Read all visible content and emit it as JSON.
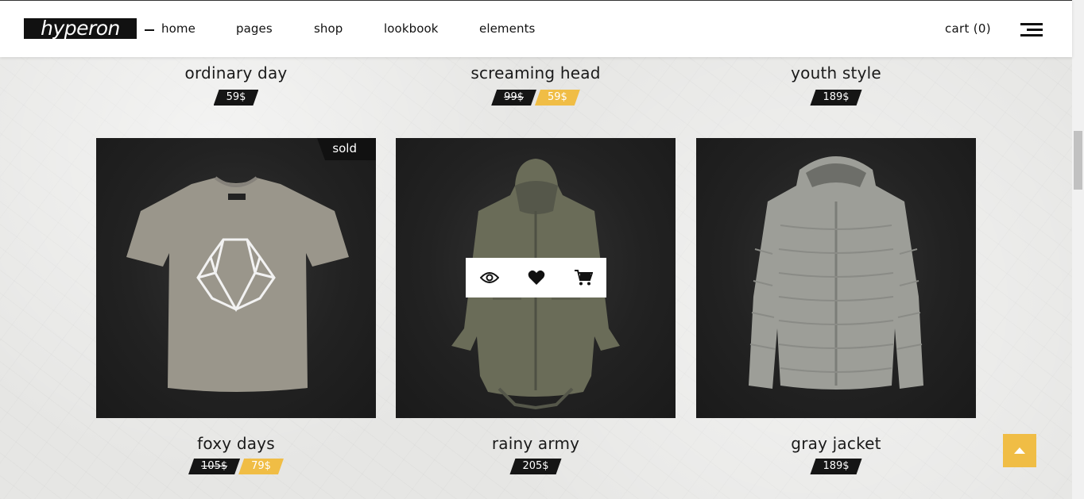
{
  "header": {
    "logo": "hyperon",
    "nav": [
      {
        "label": "home"
      },
      {
        "label": "pages"
      },
      {
        "label": "shop"
      },
      {
        "label": "lookbook"
      },
      {
        "label": "elements"
      }
    ],
    "cart_label": "cart (0)"
  },
  "top_row": [
    {
      "name": "ordinary day",
      "price": "59$"
    },
    {
      "name": "screaming head",
      "old_price": "99$",
      "sale_price": "59$"
    },
    {
      "name": "youth style",
      "price": "189$"
    }
  ],
  "products": [
    {
      "name": "foxy days",
      "old_price": "105$",
      "sale_price": "79$",
      "badge": "sold",
      "image": "t-shirt-image"
    },
    {
      "name": "rainy army",
      "price": "205$",
      "image": "parka-image"
    },
    {
      "name": "gray jacket",
      "price": "189$",
      "image": "puffer-jacket-image"
    }
  ],
  "icons": {
    "quick_view": "eye-icon",
    "wishlist": "heart-icon",
    "add_to_cart": "cart-icon",
    "back_to_top": "arrow-up-icon",
    "menu": "hamburger-menu-icon"
  },
  "colors": {
    "accent": "#f0bd45",
    "dark": "#151515",
    "header_bg": "#ffffff"
  }
}
